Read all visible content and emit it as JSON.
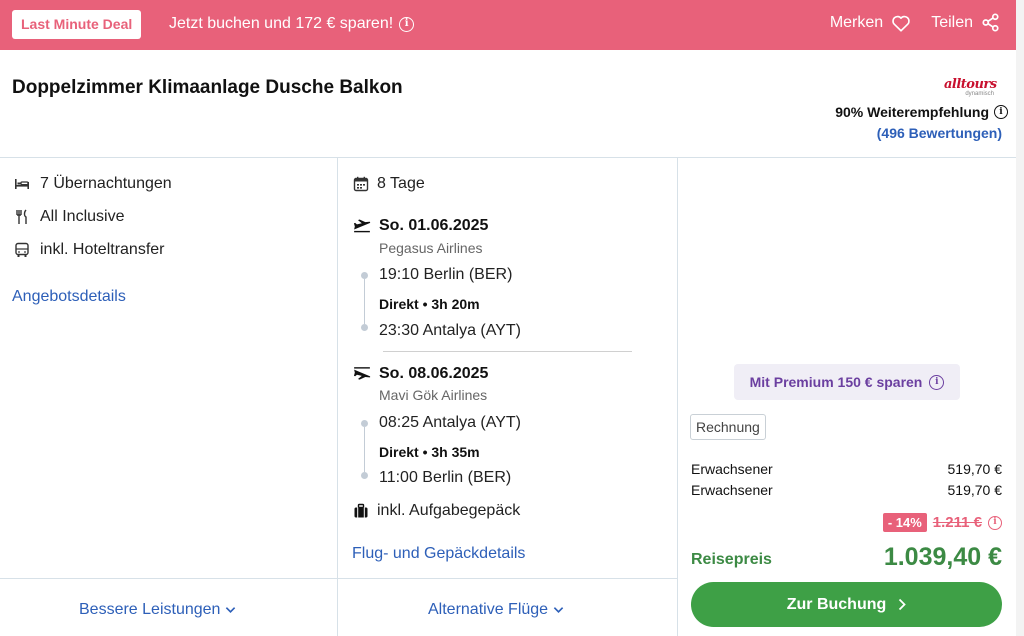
{
  "banner": {
    "badge": "Last Minute Deal",
    "promo": "Jetzt buchen und 172 € sparen!",
    "save_label": "Merken",
    "share_label": "Teilen"
  },
  "offer": {
    "title": "Doppelzimmer Klimaanlage Dusche Balkon",
    "brand_wordmark": "alltours",
    "brand_sub": "dynamisch",
    "recommendation": "90% Weiterempfehlung",
    "reviews": "(496 Bewertungen)"
  },
  "features": [
    {
      "icon": "bed-icon",
      "label": "7 Übernachtungen"
    },
    {
      "icon": "cutlery-icon",
      "label": "All Inclusive"
    },
    {
      "icon": "bus-icon",
      "label": "inkl. Hoteltransfer"
    }
  ],
  "links": {
    "offer_details": "Angebotsdetails",
    "flight_details": "Flug- und Gepäckdetails",
    "better_services": "Bessere Leistungen",
    "alternative_flights": "Alternative Flüge"
  },
  "trip": {
    "duration": "8 Tage",
    "outbound": {
      "date": "So. 01.06.2025",
      "airline": "Pegasus Airlines",
      "departure": "19:10 Berlin (BER)",
      "info": "Direkt • 3h 20m",
      "arrival": "23:30 Antalya (AYT)"
    },
    "return": {
      "date": "So. 08.06.2025",
      "airline": "Mavi Gök Airlines",
      "departure": "08:25 Antalya (AYT)",
      "info": "Direkt • 3h 35m",
      "arrival": "11:00 Berlin (BER)"
    },
    "baggage": "inkl. Aufgabegepäck"
  },
  "pricing": {
    "premium": "Mit Premium 150 € sparen",
    "invoice_tag": "Rechnung",
    "passengers": [
      {
        "type": "Erwachsener",
        "price": "519,70 €"
      },
      {
        "type": "Erwachsener",
        "price": "519,70 €"
      }
    ],
    "discount": "- 14%",
    "old_price": "1.211 €",
    "total_label": "Reisepreis",
    "total": "1.039,40 €",
    "book_label": "Zur Buchung"
  },
  "colors": {
    "banner": "#e8617a",
    "link": "#2d5fb8",
    "price_green": "#3c8a44",
    "button_green": "#3ea046",
    "premium_purple": "#6b3fa0"
  }
}
